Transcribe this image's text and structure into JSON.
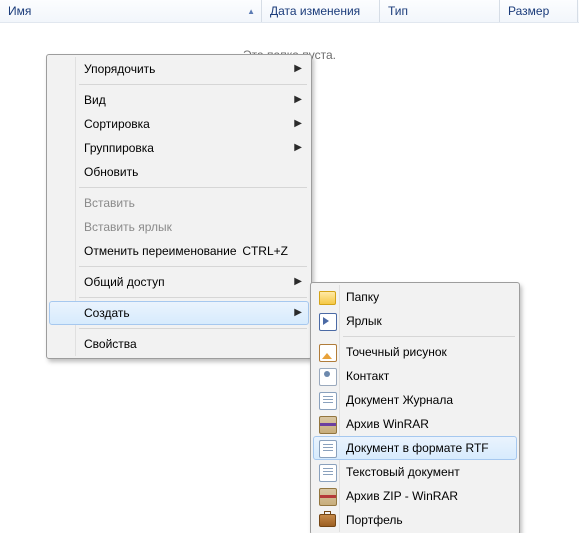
{
  "header": {
    "cols": [
      {
        "label": "Имя",
        "sort": "▲"
      },
      {
        "label": "Дата изменения",
        "sort": ""
      },
      {
        "label": "Тип",
        "sort": ""
      },
      {
        "label": "Размер",
        "sort": ""
      }
    ]
  },
  "empty_text": "Эта папка пуста.",
  "ctx": {
    "arrange": "Упорядочить",
    "view": "Вид",
    "sort": "Сортировка",
    "group": "Группировка",
    "refresh": "Обновить",
    "paste": "Вставить",
    "paste_shortcut": "Вставить ярлык",
    "undo_rename": "Отменить переименование",
    "undo_shortcut_key": "CTRL+Z",
    "share": "Общий доступ",
    "new": "Создать",
    "properties": "Свойства"
  },
  "sub": {
    "folder": "Папку",
    "shortcut": "Ярлык",
    "bmp": "Точечный рисунок",
    "contact": "Контакт",
    "journal": "Документ Журнала",
    "rar": "Архив WinRAR",
    "rtf": "Документ в формате RTF",
    "txt": "Текстовый документ",
    "zip": "Архив ZIP - WinRAR",
    "briefcase": "Портфель"
  }
}
